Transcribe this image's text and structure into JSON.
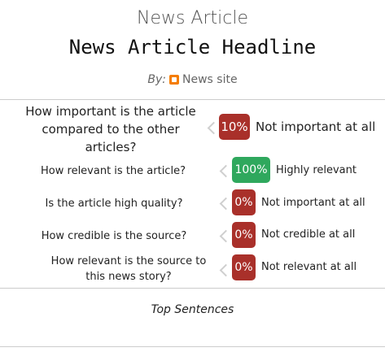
{
  "article": {
    "section_title": "News Article",
    "headline": "News Article Headline",
    "by_label": "By:",
    "site_icon": "blogger-icon",
    "site_name": "News site"
  },
  "ratings": [
    {
      "question": "How important is the article compared to the other articles?",
      "score": "10%",
      "answer": "Not important at all",
      "color": "#a9302a"
    },
    {
      "question": "How relevant is the article?",
      "score": "100%",
      "answer": "Highly relevant",
      "color": "#2fa85d"
    },
    {
      "question": "Is the article high quality?",
      "score": "0%",
      "answer": "Not important at all",
      "color": "#a9302a"
    },
    {
      "question": "How credible is the source?",
      "score": "0%",
      "answer": "Not credible at all",
      "color": "#a9302a"
    },
    {
      "question": "How relevant is the source to this news story?",
      "score": "0%",
      "answer": "Not relevant at all",
      "color": "#a9302a"
    }
  ],
  "top_sentences_label": "Top Sentences"
}
